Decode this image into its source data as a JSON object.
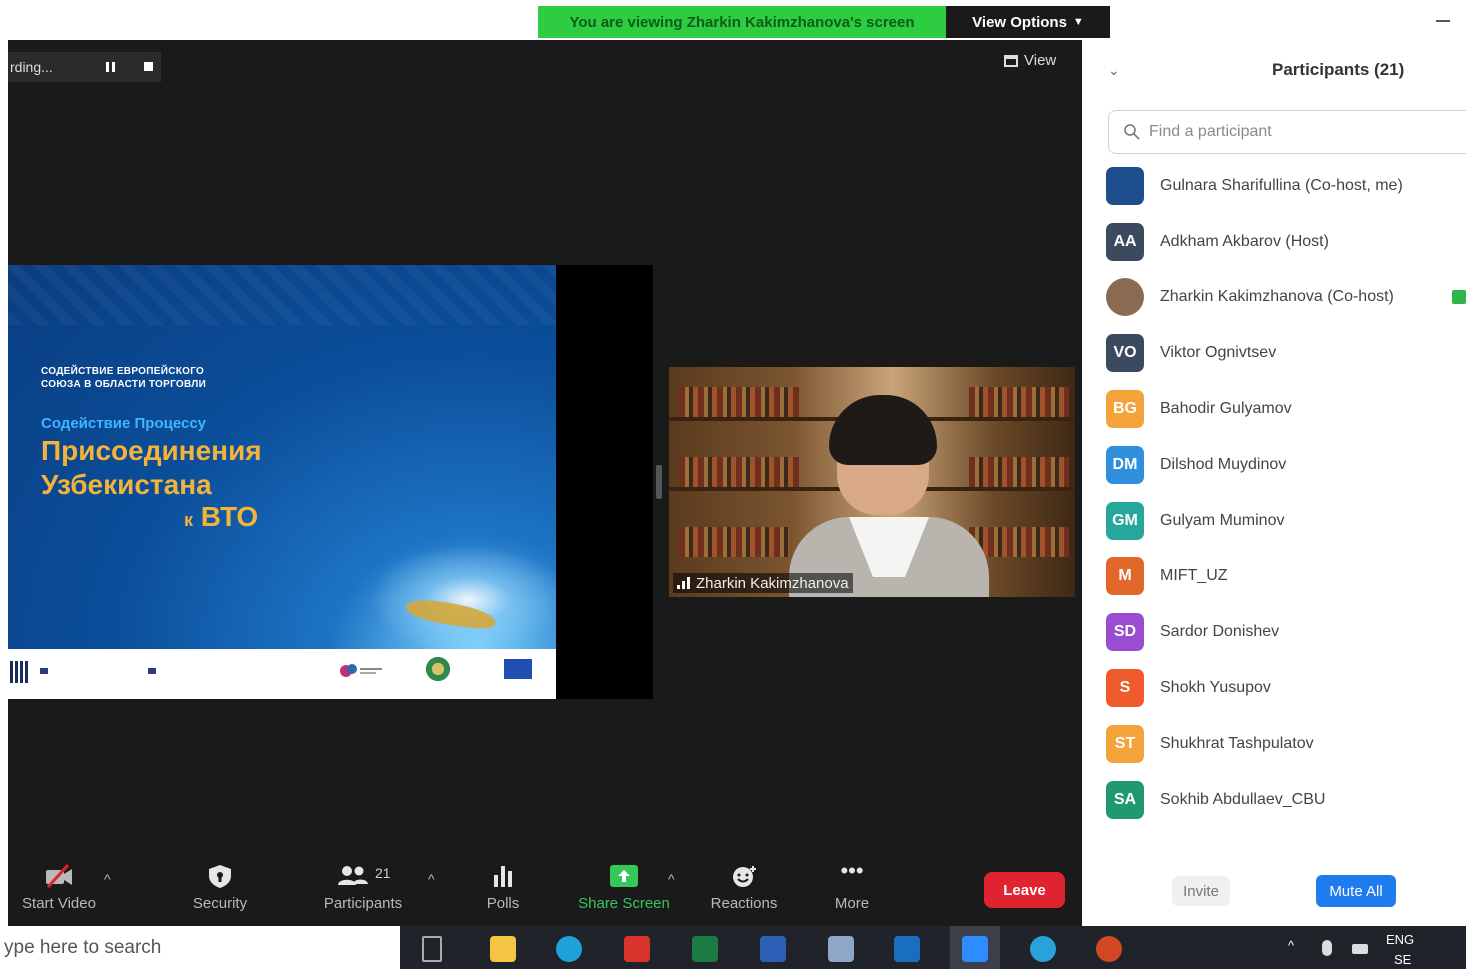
{
  "banner": {
    "viewing_text": "You are viewing Zharkin Kakimzhanova's screen",
    "view_options_label": "View Options"
  },
  "recording": {
    "label": "rding..."
  },
  "view_button": {
    "label": "View"
  },
  "slide": {
    "org_line1": "СОДЕЙСТВИЕ ЕВРОПЕЙСКОГО",
    "org_line2": "СОЮЗА В ОБЛАСТИ ТОРГОВЛИ",
    "subtitle": "Содействие Процессу",
    "title_line1": "Присоединения",
    "title_line2": "Узбекистана",
    "title_line3_small": "к",
    "title_line3": "ВТО"
  },
  "speaker": {
    "name": "Zharkin Kakimzhanova"
  },
  "toolbar": {
    "start_video": "Start Video",
    "security": "Security",
    "participants": "Participants",
    "participants_count": "21",
    "polls": "Polls",
    "share_screen": "Share Screen",
    "reactions": "Reactions",
    "more": "More",
    "leave": "Leave"
  },
  "panel": {
    "title": "Participants (21)",
    "search_placeholder": "Find a participant",
    "participants": [
      {
        "initials": "",
        "name": "Gulnara Sharifullina (Co-host, me)",
        "color": "#1f4e8c"
      },
      {
        "initials": "AA",
        "name": "Adkham Akbarov (Host)",
        "color": "#3b4a5e"
      },
      {
        "initials": "",
        "name": "Zharkin Kakimzhanova (Co-host)",
        "color": "#8a6a50"
      },
      {
        "initials": "VO",
        "name": "Viktor Ognivtsev",
        "color": "#3b4a5e"
      },
      {
        "initials": "BG",
        "name": "Bahodir Gulyamov",
        "color": "#f3a33a"
      },
      {
        "initials": "DM",
        "name": "Dilshod Muydinov",
        "color": "#2f8fdc"
      },
      {
        "initials": "GM",
        "name": "Gulyam Muminov",
        "color": "#27a79c"
      },
      {
        "initials": "M",
        "name": "MIFT_UZ",
        "color": "#e2672a"
      },
      {
        "initials": "SD",
        "name": "Sardor Donishev",
        "color": "#9b4dd1"
      },
      {
        "initials": "S",
        "name": "Shokh Yusupov",
        "color": "#f05a2c"
      },
      {
        "initials": "ST",
        "name": "Shukhrat Tashpulatov",
        "color": "#f3a33a"
      },
      {
        "initials": "SA",
        "name": "Sokhib Abdullaev_CBU",
        "color": "#1f9a6e"
      }
    ],
    "invite": "Invite",
    "mute_all": "Mute All"
  },
  "taskbar": {
    "search_text": "ype here to search",
    "lang": "ENG",
    "lang2": "SE"
  }
}
